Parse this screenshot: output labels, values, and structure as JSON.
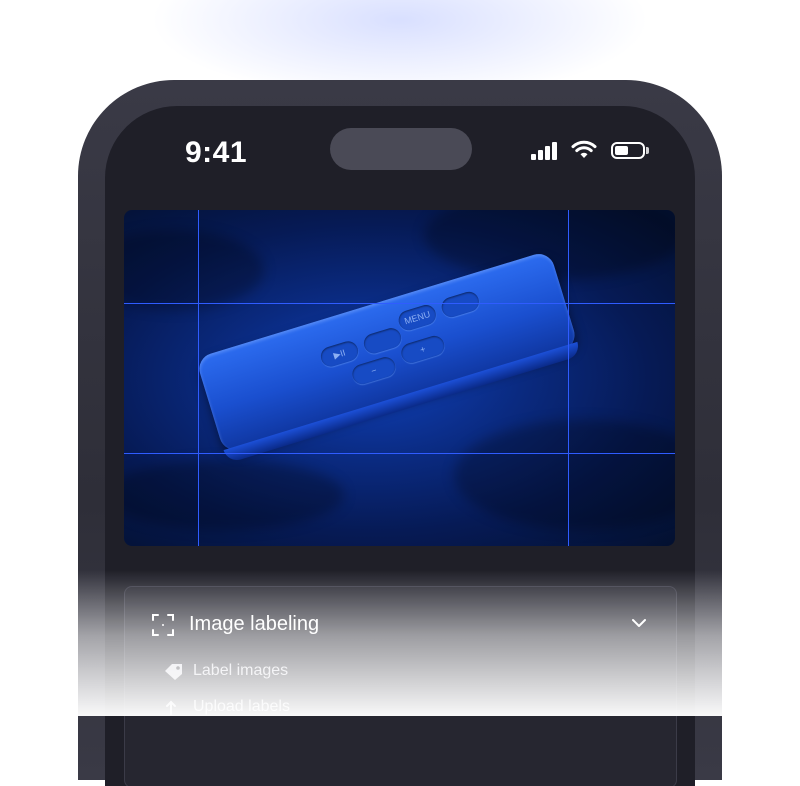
{
  "status_bar": {
    "time": "9:41",
    "signal_icon": "cellular-signal-icon",
    "wifi_icon": "wifi-icon",
    "battery_icon": "battery-icon"
  },
  "camera": {
    "subject": "remote control",
    "remote_buttons": [
      "MENU",
      "",
      "▶II",
      "",
      "−",
      "+"
    ],
    "grid_color": "#2f5cff"
  },
  "menu": {
    "title": "Image labeling",
    "title_icon": "scan-frame-icon",
    "expand_icon": "chevron-down-icon",
    "items": [
      {
        "label": "Label images",
        "icon": "tag-icon"
      },
      {
        "label": "Upload labels",
        "icon": "upload-icon"
      }
    ]
  },
  "colors": {
    "frame": "#2e2e38",
    "screen": "#1f1f28",
    "accent": "#2f5cff"
  }
}
